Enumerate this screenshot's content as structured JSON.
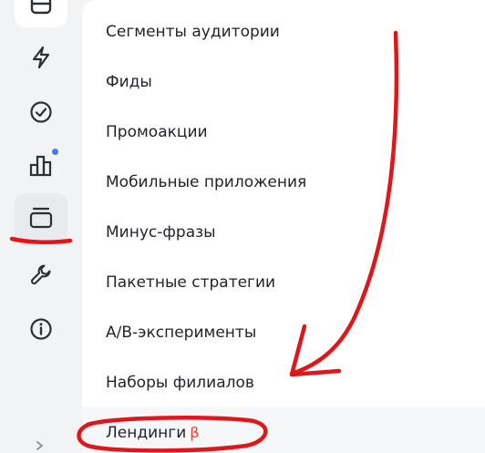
{
  "sidebar": {
    "icons": [
      {
        "name": "cards-icon",
        "state": "default"
      },
      {
        "name": "lightning-icon",
        "state": "default"
      },
      {
        "name": "check-circle-icon",
        "state": "default"
      },
      {
        "name": "bar-chart-icon",
        "state": "notification"
      },
      {
        "name": "library-icon",
        "state": "active"
      },
      {
        "name": "wrench-icon",
        "state": "default"
      },
      {
        "name": "info-icon",
        "state": "default"
      }
    ],
    "notification_color": "#3f7cff"
  },
  "menu": {
    "items": [
      {
        "label": "Сегменты аудитории"
      },
      {
        "label": "Фиды"
      },
      {
        "label": "Промоакции"
      },
      {
        "label": "Мобильные приложения"
      },
      {
        "label": "Минус-фразы"
      },
      {
        "label": "Пакетные стратегии"
      },
      {
        "label": "A/B-эксперименты"
      },
      {
        "label": "Наборы филиалов"
      },
      {
        "label": "Лендинги",
        "badge": "β"
      }
    ]
  },
  "colors": {
    "annotation": "#e0161b",
    "beta_badge": "#ff3b30",
    "text": "#21242b"
  }
}
